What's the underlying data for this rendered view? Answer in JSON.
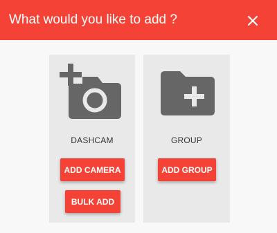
{
  "dialog": {
    "title": "What would you like to add ?",
    "close_icon": "close-icon",
    "accent_color": "#f44336"
  },
  "options": [
    {
      "icon": "add-camera-icon",
      "label": "DASHCAM",
      "buttons": [
        "ADD CAMERA",
        "BULK ADD"
      ]
    },
    {
      "icon": "folder-add-icon",
      "label": "GROUP",
      "buttons": [
        "ADD GROUP"
      ]
    }
  ]
}
